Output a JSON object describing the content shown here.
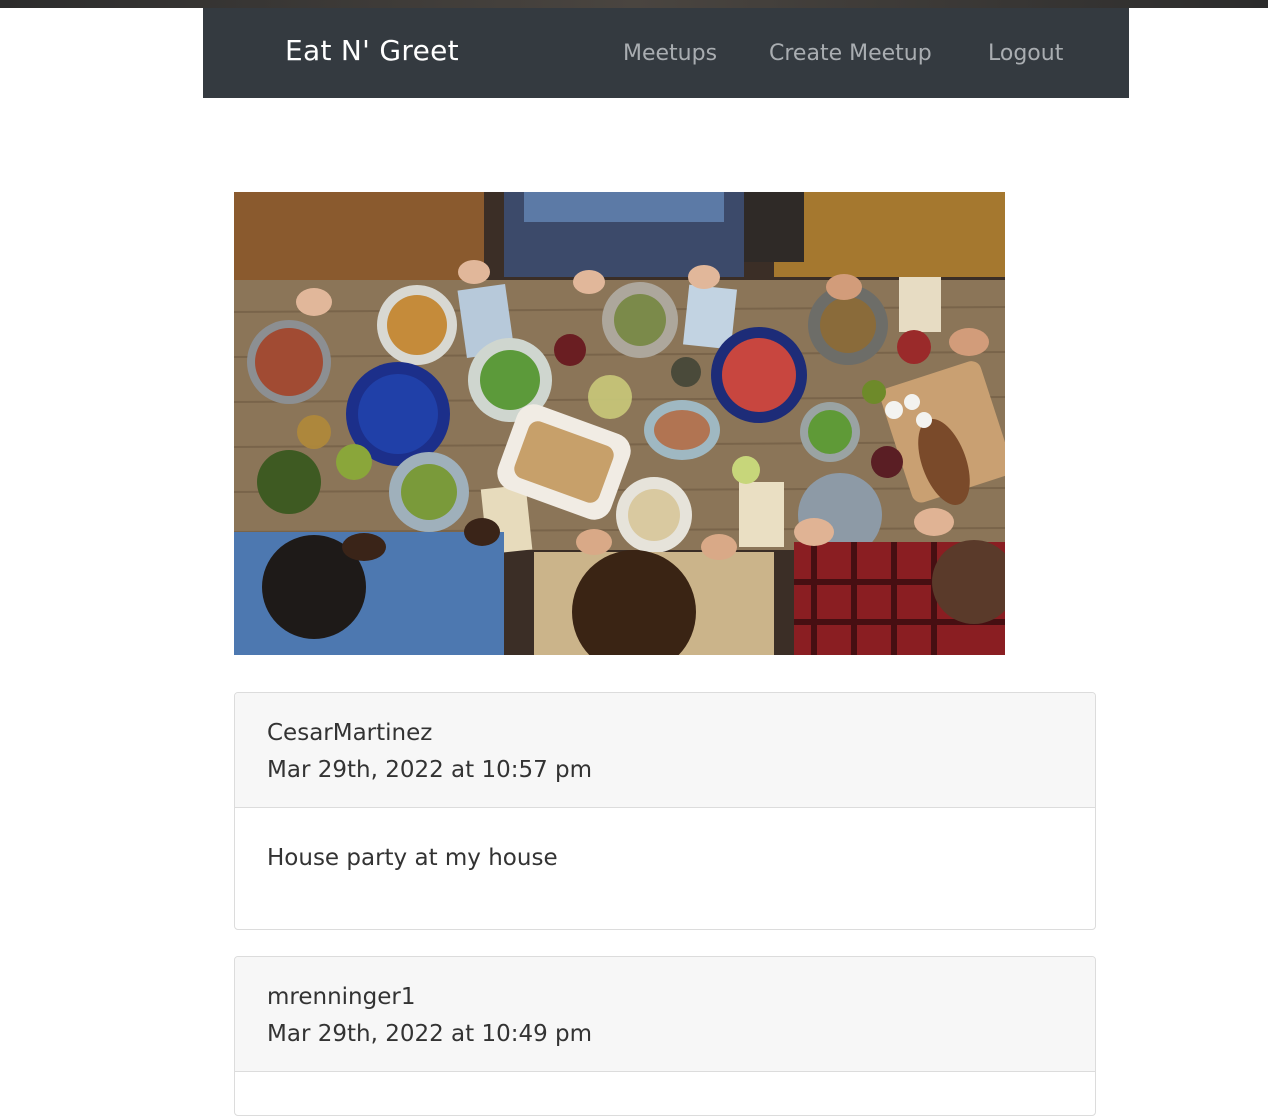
{
  "nav": {
    "brand": "Eat N' Greet",
    "links": [
      {
        "label": "Meetups"
      },
      {
        "label": "Create Meetup"
      },
      {
        "label": "Logout"
      }
    ]
  },
  "hero": {
    "icon": "group-dinner-photo"
  },
  "posts": [
    {
      "user": "CesarMartinez",
      "date": "Mar 29th, 2022 at 10:57 pm",
      "text": "House party at my house"
    },
    {
      "user": "mrenninger1",
      "date": "Mar 29th, 2022 at 10:49 pm",
      "text": ""
    }
  ]
}
